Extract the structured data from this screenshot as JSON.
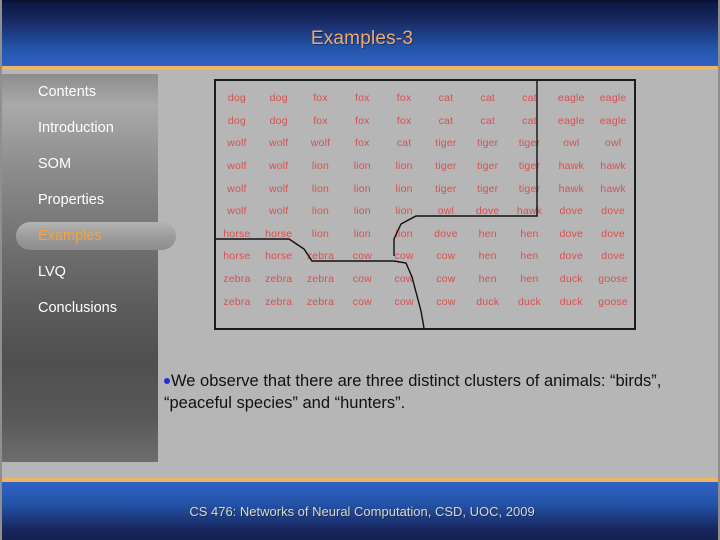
{
  "slide": {
    "title": "Examples-3",
    "title_color": "#f2a968",
    "footer": "CS 476: Networks of Neural Computation, CSD, UOC, 2009"
  },
  "sidebar": {
    "items": [
      {
        "label": "Contents",
        "active": false
      },
      {
        "label": "Introduction",
        "active": false
      },
      {
        "label": "SOM",
        "active": false
      },
      {
        "label": "Properties",
        "active": false
      },
      {
        "label": "Examples",
        "active": true
      },
      {
        "label": "LVQ",
        "active": false
      },
      {
        "label": "Conclusions",
        "active": false
      }
    ],
    "active_color": "#f6a33c",
    "item_color": "#ffffff"
  },
  "som_map": {
    "word_color": "#d8504f",
    "rows": 10,
    "cols": 10,
    "cells": [
      [
        "dog",
        "dog",
        "fox",
        "fox",
        "fox",
        "cat",
        "cat",
        "cat",
        "eagle",
        "eagle"
      ],
      [
        "dog",
        "dog",
        "fox",
        "fox",
        "fox",
        "cat",
        "cat",
        "cat",
        "eagle",
        "eagle"
      ],
      [
        "wolf",
        "wolf",
        "wolf",
        "fox",
        "cat",
        "tiger",
        "tiger",
        "tiger",
        "owl",
        "owl"
      ],
      [
        "wolf",
        "wolf",
        "lion",
        "lion",
        "lion",
        "tiger",
        "tiger",
        "tiger",
        "hawk",
        "hawk"
      ],
      [
        "wolf",
        "wolf",
        "lion",
        "lion",
        "lion",
        "tiger",
        "tiger",
        "tiger",
        "hawk",
        "hawk"
      ],
      [
        "wolf",
        "wolf",
        "lion",
        "lion",
        "lion",
        "owl",
        "dove",
        "hawk",
        "dove",
        "dove"
      ],
      [
        "horse",
        "horse",
        "lion",
        "lion",
        "lion",
        "dove",
        "hen",
        "hen",
        "dove",
        "dove"
      ],
      [
        "horse",
        "horse",
        "zebra",
        "cow",
        "cow",
        "cow",
        "hen",
        "hen",
        "dove",
        "dove"
      ],
      [
        "zebra",
        "zebra",
        "zebra",
        "cow",
        "cow",
        "cow",
        "hen",
        "hen",
        "duck",
        "goose"
      ],
      [
        "zebra",
        "zebra",
        "zebra",
        "cow",
        "cow",
        "cow",
        "duck",
        "duck",
        "duck",
        "goose"
      ]
    ]
  },
  "body": {
    "bullet_color": "#2a2ad0",
    "text": "We observe that there are three distinct clusters of animals: “birds”, “peaceful species” and “hunters”."
  }
}
